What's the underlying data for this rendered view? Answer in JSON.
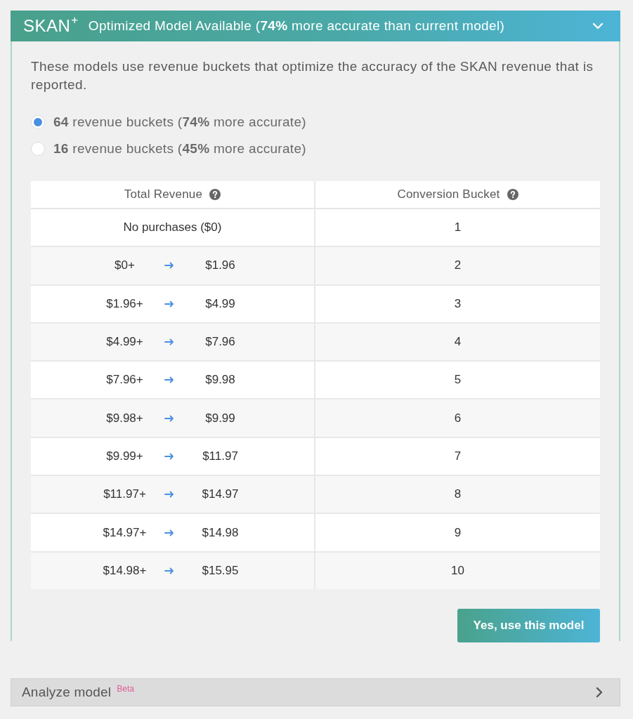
{
  "header": {
    "logo": "SKAN$^{+}$",
    "title": "Optimized Model Available (**74%** more accurate than current model)",
    "expanded": true
  },
  "description": "These models use revenue buckets that optimize the accuracy of the SKAN revenue that is reported.",
  "options": [
    {
      "label": "**64** revenue buckets (**74%** more accurate)",
      "selected": true
    },
    {
      "label": "**16** revenue buckets (**45%** more accurate)",
      "selected": false
    }
  ],
  "table": {
    "columns": [
      "Total Revenue",
      "Conversion Bucket"
    ],
    "rows": [
      {
        "kind": "single",
        "revenue": "No purchases ($0)",
        "bucket": "1"
      },
      {
        "kind": "range",
        "from": "$0+",
        "to": "$1.96",
        "bucket": "2"
      },
      {
        "kind": "range",
        "from": "$1.96+",
        "to": "$4.99",
        "bucket": "3"
      },
      {
        "kind": "range",
        "from": "$4.99+",
        "to": "$7.96",
        "bucket": "4"
      },
      {
        "kind": "range",
        "from": "$7.96+",
        "to": "$9.98",
        "bucket": "5"
      },
      {
        "kind": "range",
        "from": "$9.98+",
        "to": "$9.99",
        "bucket": "6"
      },
      {
        "kind": "range",
        "from": "$9.99+",
        "to": "$11.97",
        "bucket": "7"
      },
      {
        "kind": "range",
        "from": "$11.97+",
        "to": "$14.97",
        "bucket": "8"
      },
      {
        "kind": "range",
        "from": "$14.97+",
        "to": "$14.98",
        "bucket": "9"
      },
      {
        "kind": "range",
        "from": "$14.98+",
        "to": "$15.95",
        "bucket": "10"
      }
    ]
  },
  "button": {
    "label": "Yes, use this model"
  },
  "analyze": {
    "label": "Analyze model",
    "badge": "Beta",
    "expanded": false
  }
}
